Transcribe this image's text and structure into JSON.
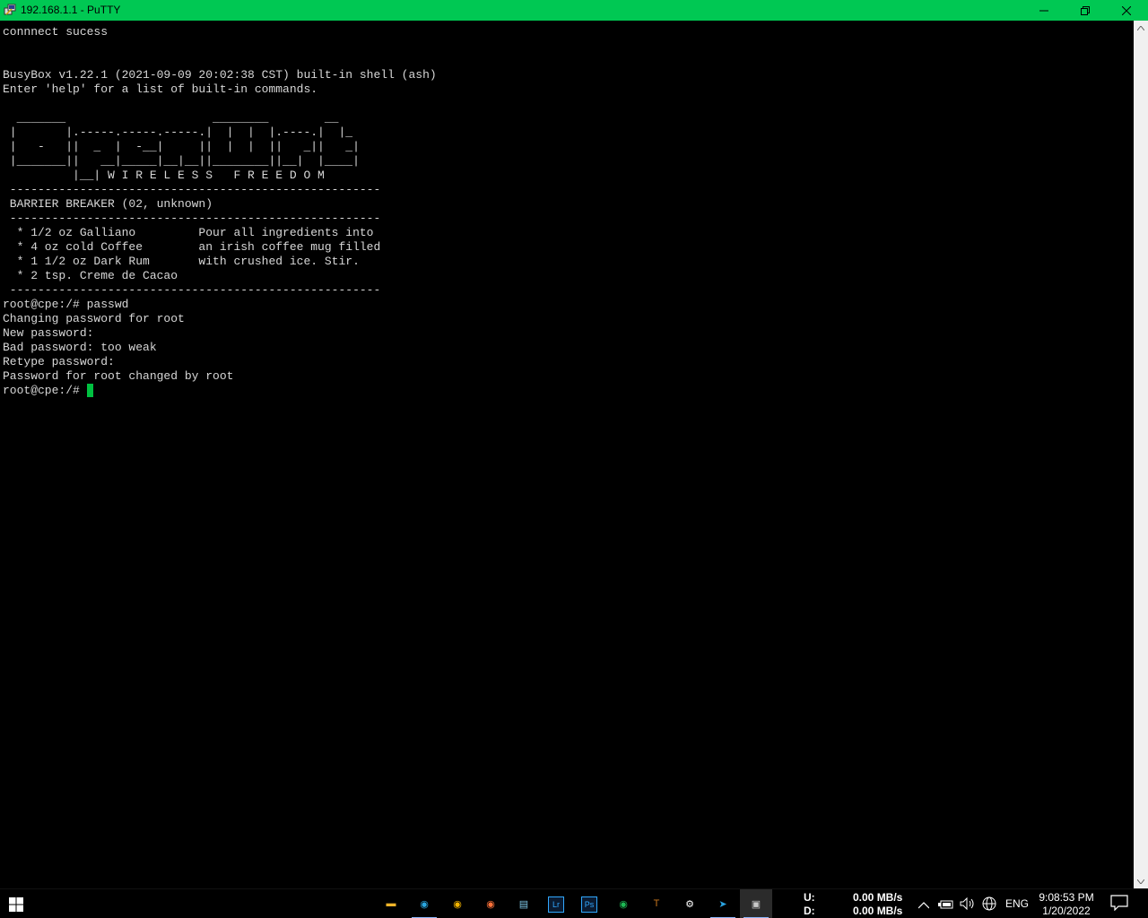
{
  "window": {
    "title": "192.168.1.1 - PuTTY",
    "icon": "putty-icon",
    "controls": {
      "minimize": "—",
      "restore": "❐",
      "close": "✕"
    }
  },
  "terminal": {
    "lines": [
      "connnect sucess",
      "",
      "",
      "BusyBox v1.22.1 (2021-09-09 20:02:38 CST) built-in shell (ash)",
      "Enter 'help' for a list of built-in commands.",
      "",
      "  _______                     ________        __",
      " |       |.-----.-----.-----.|  |  |  |.----.|  |_",
      " |   -   ||  _  |  -__|     ||  |  |  ||   _||   _|",
      " |_______||   __|_____|__|__||________||__|  |____|",
      "          |__| W I R E L E S S   F R E E D O M",
      " -----------------------------------------------------",
      " BARRIER BREAKER (02, unknown)",
      " -----------------------------------------------------",
      "  * 1/2 oz Galliano         Pour all ingredients into",
      "  * 4 oz cold Coffee        an irish coffee mug filled",
      "  * 1 1/2 oz Dark Rum       with crushed ice. Stir.",
      "  * 2 tsp. Creme de Cacao",
      " -----------------------------------------------------",
      "root@cpe:/# passwd",
      "Changing password for root",
      "New password:",
      "Bad password: too weak",
      "Retype password:",
      "Password for root changed by root"
    ],
    "prompt": "root@cpe:/# ",
    "cursor_color": "#00c040",
    "text_color": "#d7d7d7",
    "background": "#000000"
  },
  "taskbar": {
    "apps": [
      {
        "name": "file-explorer-icon",
        "glyph": "▬",
        "color": "#f0b429"
      },
      {
        "name": "edge-icon",
        "glyph": "◉",
        "color": "#2aa6df"
      },
      {
        "name": "chrome-icon",
        "glyph": "◉",
        "color": "#f4b400"
      },
      {
        "name": "firefox-icon",
        "glyph": "◉",
        "color": "#ff7139"
      },
      {
        "name": "notepad-icon",
        "glyph": "▤",
        "color": "#7ec6e6"
      },
      {
        "name": "lightroom-icon",
        "glyph": "Lr",
        "color": "#31a8ff"
      },
      {
        "name": "photoshop-icon",
        "glyph": "Ps",
        "color": "#31a8ff"
      },
      {
        "name": "spotify-icon",
        "glyph": "◉",
        "color": "#1db954"
      },
      {
        "name": "t-app-icon",
        "glyph": "T",
        "color": "#c8761e"
      },
      {
        "name": "settings-icon",
        "glyph": "⚙",
        "color": "#ffffff"
      },
      {
        "name": "telegram-icon",
        "glyph": "➤",
        "color": "#2aa3e0"
      },
      {
        "name": "putty-taskbar-icon",
        "glyph": "▣",
        "color": "#c9c9c9"
      }
    ],
    "netspeed": {
      "upload_label": "U:",
      "download_label": "D:",
      "upload_value": "0.00 MB/s",
      "download_value": "0.00 MB/s"
    },
    "tray": {
      "chevron": "^",
      "battery": "▭",
      "volume": "🔊",
      "network": "🌐",
      "language": "ENG"
    },
    "clock": {
      "time": "9:08:53 PM",
      "date": "1/20/2022"
    },
    "notification_icon": "notification-icon"
  }
}
